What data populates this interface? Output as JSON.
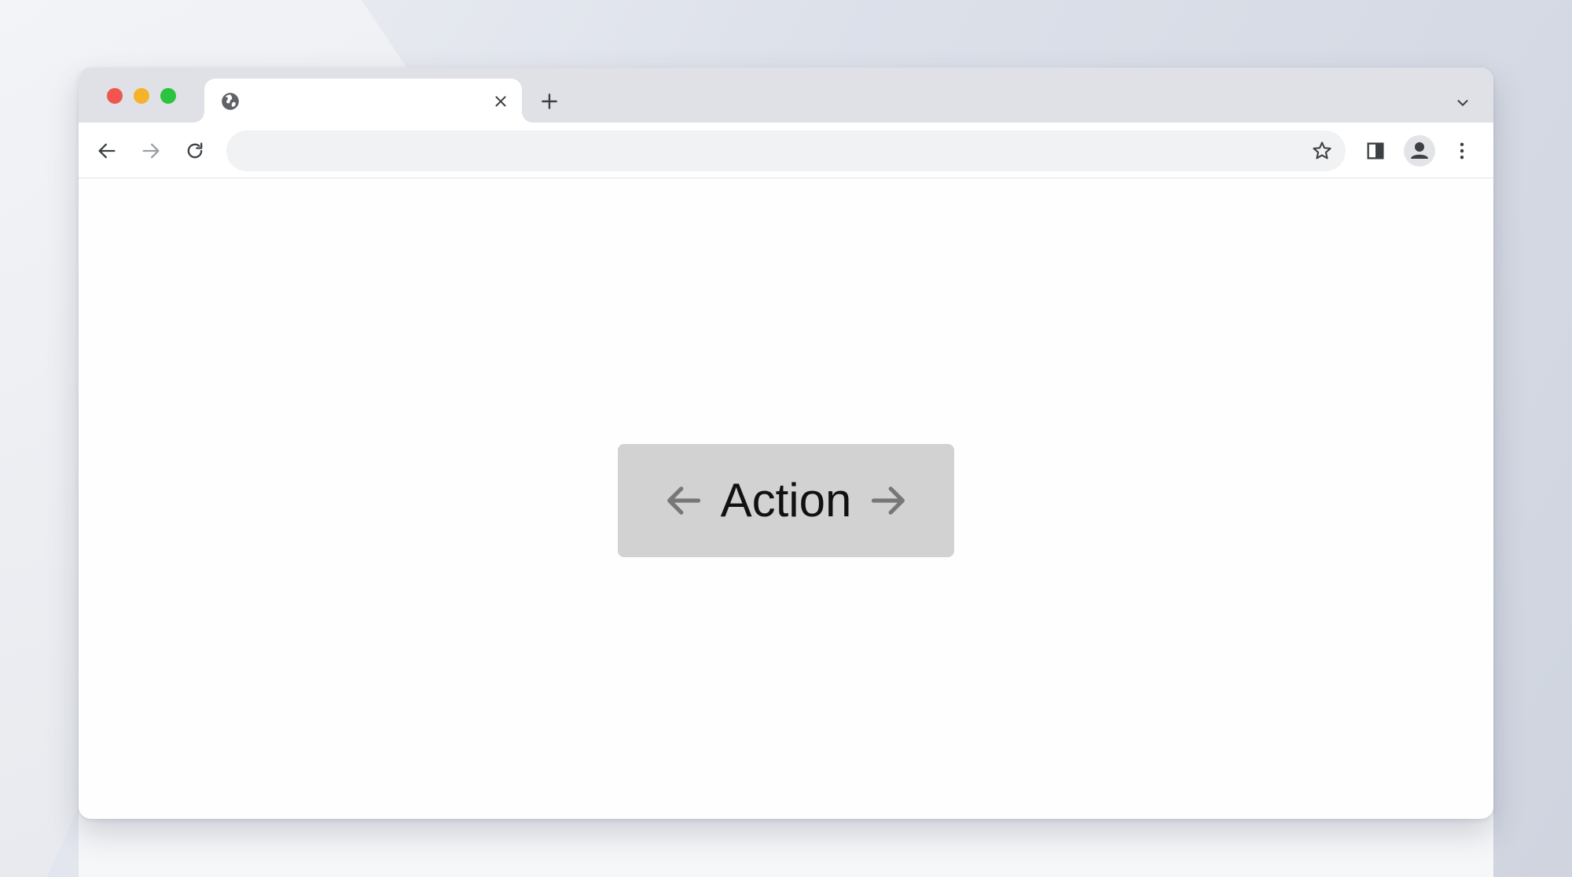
{
  "window": {
    "tab": {
      "title": "",
      "favicon": "globe-icon"
    },
    "traffic_lights": {
      "close_color": "#f05550",
      "minimize_color": "#f5b32b",
      "maximize_color": "#2bc43f"
    }
  },
  "toolbar": {
    "address_value": "",
    "address_placeholder": "",
    "icons": [
      "back-arrow-icon",
      "forward-arrow-icon",
      "reload-icon",
      "star-icon",
      "side-panel-icon",
      "profile-icon",
      "kebab-menu-icon"
    ]
  },
  "content": {
    "action_button": {
      "label": "Action",
      "background": "#d2d2d2",
      "left_icon": "arrow-left-icon",
      "right_icon": "arrow-right-icon"
    }
  }
}
